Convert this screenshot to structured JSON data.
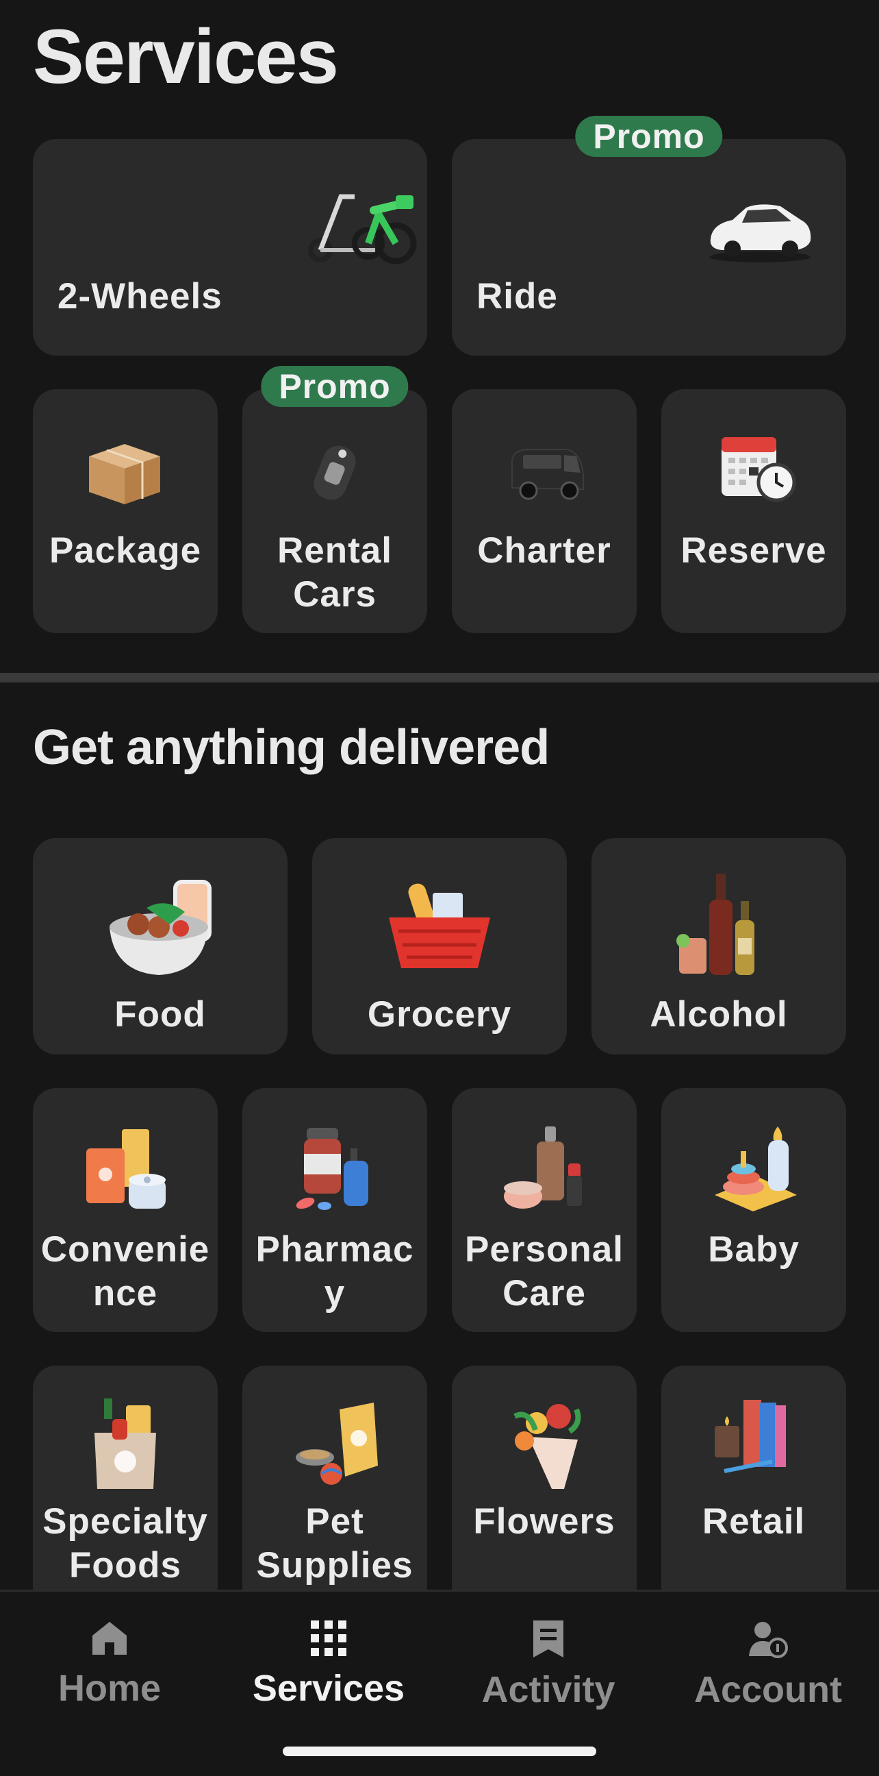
{
  "header": {
    "title": "Services"
  },
  "colors": {
    "background": "#161616",
    "tile": "#2a2a2a",
    "promo": "#2f7a4c",
    "text": "#ebebeb",
    "muted": "#8e8e8e"
  },
  "services": {
    "two_wheels": {
      "label": "2-Wheels",
      "icon": "scooter-bike-icon"
    },
    "ride": {
      "label": "Ride",
      "icon": "car-icon",
      "promo": "Promo"
    },
    "package": {
      "label": "Package",
      "icon": "package-box-icon"
    },
    "rental_cars": {
      "label": "Rental\nCars",
      "icon": "car-key-icon",
      "promo": "Promo"
    },
    "charter": {
      "label": "Charter",
      "icon": "van-icon"
    },
    "reserve": {
      "label": "Reserve",
      "icon": "calendar-clock-icon"
    }
  },
  "delivery": {
    "heading": "Get anything delivered",
    "food": {
      "label": "Food",
      "icon": "food-bowl-icon"
    },
    "grocery": {
      "label": "Grocery",
      "icon": "grocery-basket-icon"
    },
    "alcohol": {
      "label": "Alcohol",
      "icon": "wine-bottles-icon"
    },
    "convenience": {
      "label": "Convenie\nnce",
      "icon": "convenience-goods-icon"
    },
    "pharmacy": {
      "label": "Pharmac\ny",
      "icon": "pharmacy-bottles-icon"
    },
    "personal_care": {
      "label": "Personal\nCare",
      "icon": "cosmetics-icon"
    },
    "baby": {
      "label": "Baby",
      "icon": "baby-bottle-icon"
    },
    "specialty_foods": {
      "label": "Specialty\nFoods",
      "icon": "specialty-bag-icon"
    },
    "pet_supplies": {
      "label": "Pet\nSupplies",
      "icon": "pet-food-icon"
    },
    "flowers": {
      "label": "Flowers",
      "icon": "bouquet-icon"
    },
    "retail": {
      "label": "Retail",
      "icon": "books-candle-icon"
    }
  },
  "nav": {
    "home": "Home",
    "services": "Services",
    "activity": "Activity",
    "account": "Account",
    "active": "services"
  }
}
